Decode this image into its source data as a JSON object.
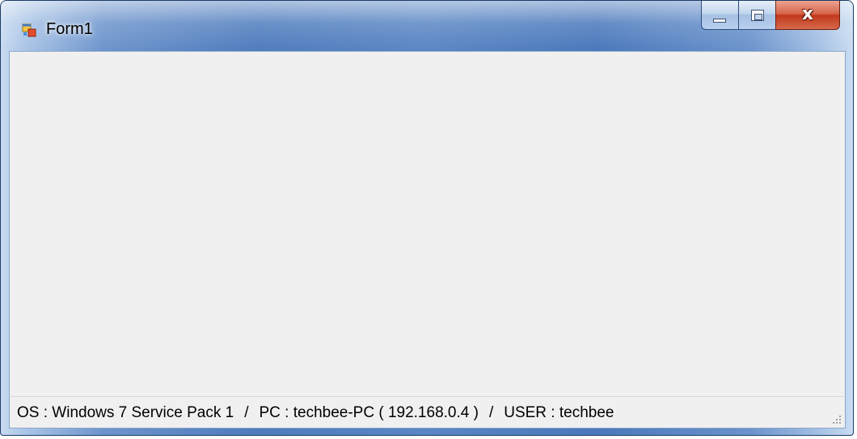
{
  "window": {
    "title": "Form1",
    "icon": "windows-form-icon",
    "buttons": {
      "minimize": "minimize-icon",
      "maximize": "maximize-icon",
      "close": "x"
    }
  },
  "statusbar": {
    "os": "OS : Windows 7 Service Pack 1",
    "separator": "/",
    "pc": "PC : techbee-PC ( 192.168.0.4 )",
    "user": "USER : techbee"
  },
  "colors": {
    "titlebar_accent": "#4f7cbd",
    "client_background": "#f0f0f0",
    "close_button": "#c2391c"
  }
}
